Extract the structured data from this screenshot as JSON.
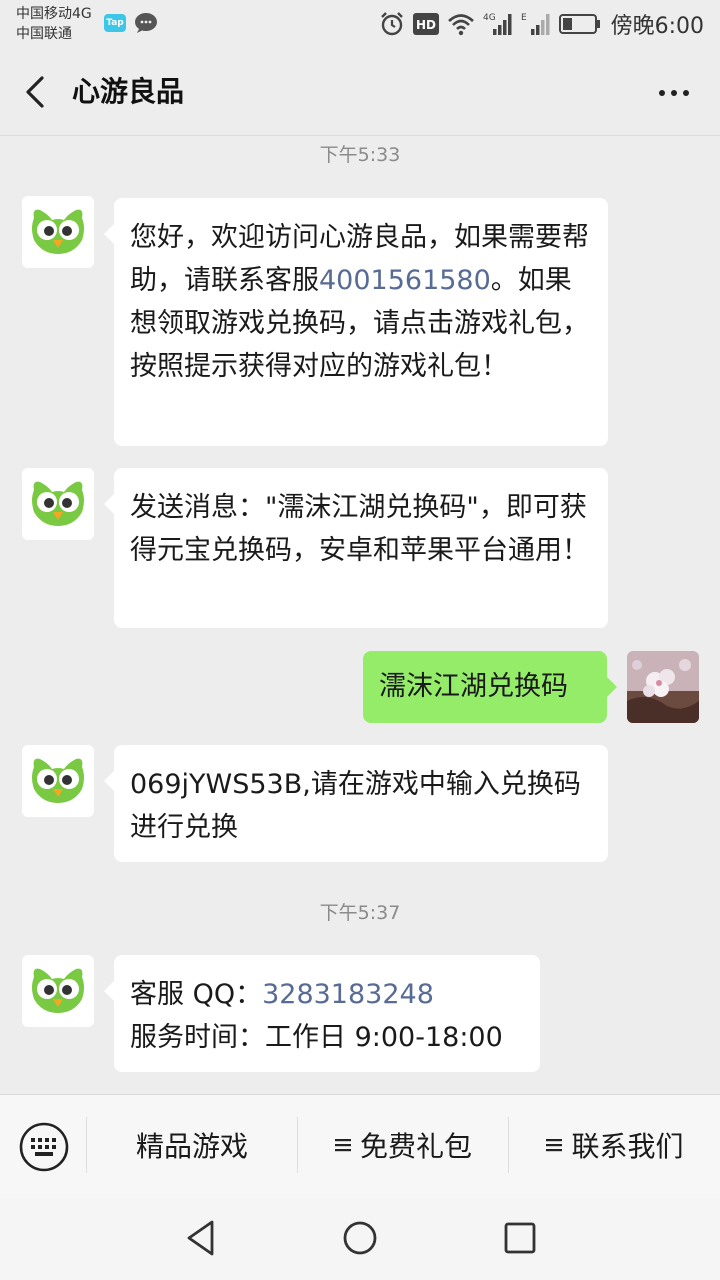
{
  "status_bar": {
    "carrier_1": "中国移动4G",
    "carrier_2": "中国联通",
    "tap_badge": "Tap",
    "hd_label": "HD",
    "net_label_1": "4G",
    "net_label_2": "E",
    "time": "傍晚6:00"
  },
  "nav": {
    "title": "心游良品"
  },
  "chat": {
    "timestamp_1": "下午5:33",
    "msg1": {
      "part1": "您好，欢迎访问心游良品，如果需要帮助，请联系客服",
      "phone": "4001561580",
      "part2": "。如果想领取游戏兑换码，请点击游戏礼包，按照提示获得对应的游戏礼包！"
    },
    "msg2": "发送消息：\"濡沫江湖兑换码\"，即可获得元宝兑换码，安卓和苹果平台通用！",
    "msg3_user": "濡沫江湖兑换码",
    "msg4": "069jYWS53B,请在游戏中输入兑换码进行兑换",
    "timestamp_2": "下午5:37",
    "msg5": {
      "qq_label": "客服 QQ：",
      "qq_number": "3283183248",
      "hours": "服务时间：工作日 9:00-18:00"
    }
  },
  "menu": {
    "item1": "精品游戏",
    "item2": "免费礼包",
    "item3": "联系我们"
  },
  "colors": {
    "background": "#ededed",
    "user_bubble": "#95ec69",
    "link": "#576b95",
    "brand_owl": "#7ac943"
  }
}
